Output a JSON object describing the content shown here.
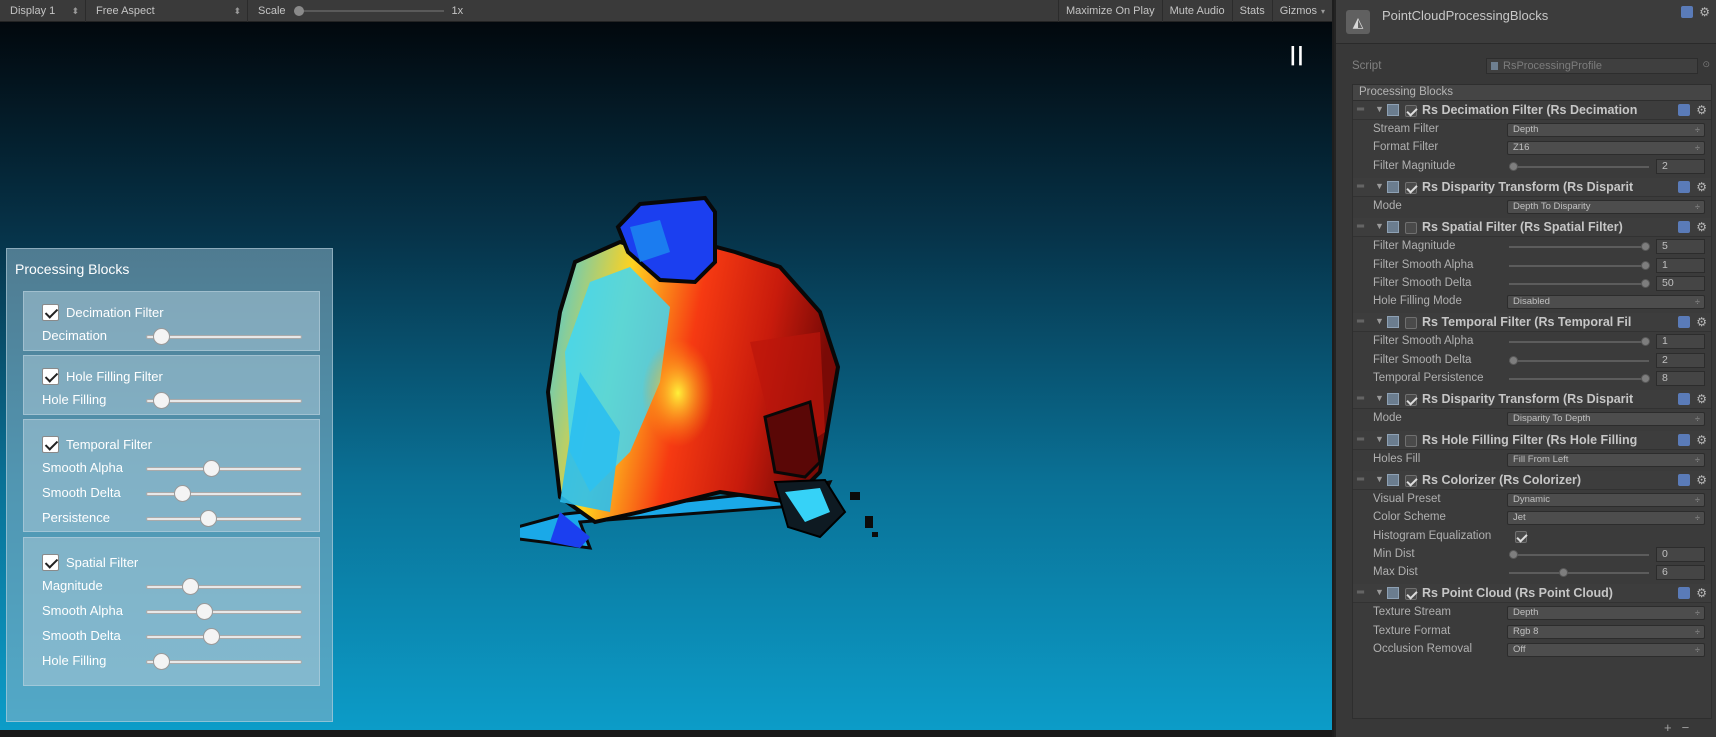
{
  "toolbar": {
    "display": "Display 1",
    "aspect": "Free Aspect",
    "scale_label": "Scale",
    "scale_value": "1x",
    "maximize": "Maximize On Play",
    "mute": "Mute Audio",
    "stats": "Stats",
    "gizmos": "Gizmos",
    "scale_level": 0.0
  },
  "game": {
    "pause_symbol": "||",
    "panel": {
      "title": "Processing Blocks",
      "groups": [
        {
          "name": "Decimation Filter",
          "checked": true,
          "rows": [
            {
              "label": "Decimation",
              "level": 0.05
            }
          ]
        },
        {
          "name": "Hole Filling Filter",
          "checked": true,
          "rows": [
            {
              "label": "Hole Filling",
              "level": 0.05
            }
          ]
        },
        {
          "name": "Temporal Filter",
          "checked": true,
          "rows": [
            {
              "label": "Smooth Alpha",
              "level": 0.4
            },
            {
              "label": "Smooth Delta",
              "level": 0.2
            },
            {
              "label": "Persistence",
              "level": 0.38
            }
          ]
        },
        {
          "name": "Spatial Filter",
          "checked": true,
          "rows": [
            {
              "label": "Magnitude",
              "level": 0.25
            },
            {
              "label": "Smooth Alpha",
              "level": 0.35
            },
            {
              "label": "Smooth Delta",
              "level": 0.4
            },
            {
              "label": "Hole Filling",
              "level": 0.05
            }
          ]
        }
      ]
    }
  },
  "inspector": {
    "title": "PointCloudProcessingBlocks",
    "script_label": "Script",
    "script_value": "RsProcessingProfile",
    "section": "Processing Blocks",
    "blocks": [
      {
        "title": "Rs Decimation Filter (Rs Decimation",
        "enabled": true,
        "props": [
          {
            "kind": "dropdown",
            "label": "Stream Filter",
            "value": "Depth"
          },
          {
            "kind": "dropdown",
            "label": "Format Filter",
            "value": "Z16"
          },
          {
            "kind": "slider",
            "label": "Filter Magnitude",
            "value": "2",
            "level": 0.0
          }
        ]
      },
      {
        "title": "Rs Disparity Transform (Rs Disparit",
        "enabled": true,
        "props": [
          {
            "kind": "dropdown",
            "label": "Mode",
            "value": "Depth To Disparity"
          }
        ]
      },
      {
        "title": "Rs Spatial Filter (Rs Spatial Filter)",
        "enabled": false,
        "props": [
          {
            "kind": "slider",
            "label": "Filter Magnitude",
            "value": "5",
            "level": 1.0
          },
          {
            "kind": "slider",
            "label": "Filter Smooth Alpha",
            "value": "1",
            "level": 1.0
          },
          {
            "kind": "slider",
            "label": "Filter Smooth Delta",
            "value": "50",
            "level": 1.0
          },
          {
            "kind": "dropdown",
            "label": "Hole Filling Mode",
            "value": "Disabled"
          }
        ]
      },
      {
        "title": "Rs Temporal Filter (Rs Temporal Fil",
        "enabled": false,
        "props": [
          {
            "kind": "slider",
            "label": "Filter Smooth Alpha",
            "value": "1",
            "level": 1.0
          },
          {
            "kind": "slider",
            "label": "Filter Smooth Delta",
            "value": "2",
            "level": 0.0
          },
          {
            "kind": "slider",
            "label": "Temporal Persistence",
            "value": "8",
            "level": 1.0
          }
        ]
      },
      {
        "title": "Rs Disparity Transform (Rs Disparit",
        "enabled": true,
        "props": [
          {
            "kind": "dropdown",
            "label": "Mode",
            "value": "Disparity To Depth"
          }
        ]
      },
      {
        "title": "Rs Hole Filling Filter (Rs Hole Filling",
        "enabled": false,
        "props": [
          {
            "kind": "dropdown",
            "label": "Holes Fill",
            "value": "Fill From Left"
          }
        ]
      },
      {
        "title": "Rs Colorizer (Rs Colorizer)",
        "enabled": true,
        "props": [
          {
            "kind": "dropdown",
            "label": "Visual Preset",
            "value": "Dynamic"
          },
          {
            "kind": "dropdown",
            "label": "Color Scheme",
            "value": "Jet"
          },
          {
            "kind": "toggle",
            "label": "Histogram Equalization",
            "checked": true
          },
          {
            "kind": "slider",
            "label": "Min Dist",
            "value": "0",
            "level": 0.0
          },
          {
            "kind": "slider",
            "label": "Max Dist",
            "value": "6",
            "level": 0.38
          }
        ]
      },
      {
        "title": "Rs Point Cloud (Rs Point Cloud)",
        "enabled": true,
        "props": [
          {
            "kind": "dropdown",
            "label": "Texture Stream",
            "value": "Depth"
          },
          {
            "kind": "dropdown",
            "label": "Texture Format",
            "value": "Rgb 8"
          },
          {
            "kind": "dropdown",
            "label": "Occlusion Removal",
            "value": "Off"
          }
        ]
      }
    ],
    "footer": {
      "add": "+",
      "remove": "−"
    }
  }
}
